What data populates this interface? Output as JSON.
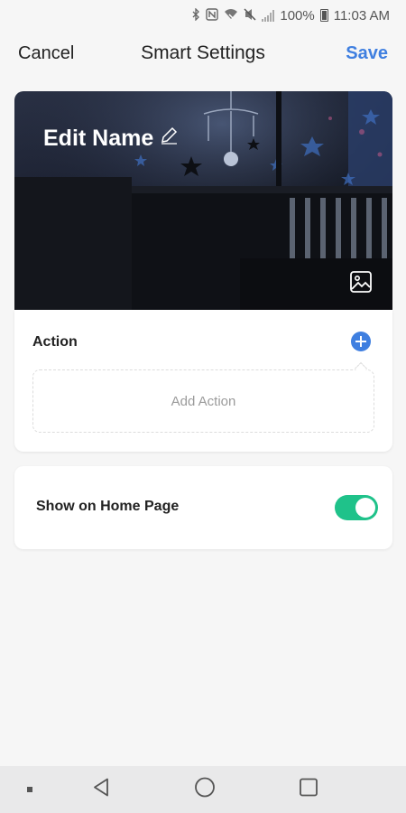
{
  "status_bar": {
    "battery": "100%",
    "time": "11:03 AM",
    "icons": [
      "bluetooth-icon",
      "nfc-icon",
      "wifi-icon",
      "mute-icon",
      "signal-icon",
      "battery-icon"
    ]
  },
  "header": {
    "cancel_label": "Cancel",
    "title": "Smart Settings",
    "save_label": "Save"
  },
  "cover": {
    "name_label": "Edit Name",
    "edit_icon": "pencil-icon",
    "image_icon": "image-icon"
  },
  "action": {
    "label": "Action",
    "add_icon": "plus-circle-icon",
    "placeholder": "Add Action"
  },
  "home_page": {
    "label": "Show on Home Page",
    "enabled": true,
    "toggle_color": "#1fc28a"
  },
  "nav_bar": {
    "icons": [
      "dot-icon",
      "back-icon",
      "home-icon",
      "recents-icon"
    ]
  },
  "colors": {
    "accent": "#3f7fe0",
    "toggle_on": "#1fc28a",
    "background": "#f6f6f6"
  }
}
